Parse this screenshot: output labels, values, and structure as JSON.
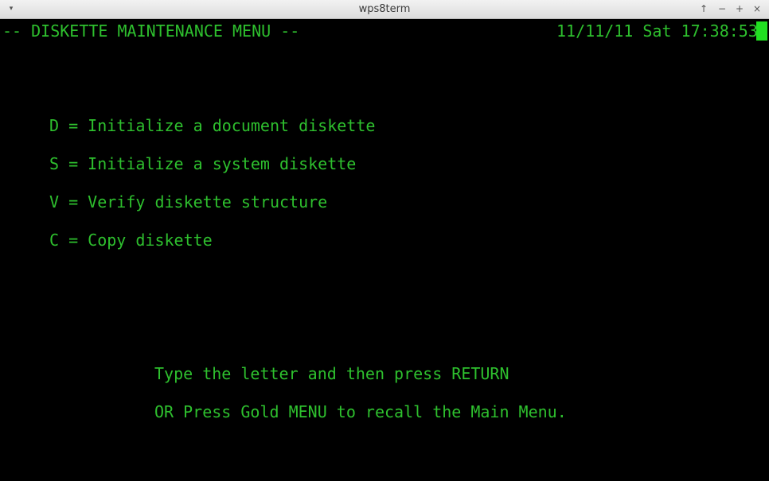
{
  "window": {
    "title": "wps8term",
    "controls": {
      "menu": "▾",
      "up": "↑",
      "minimize": "−",
      "maximize": "+",
      "close": "×"
    }
  },
  "terminal": {
    "colors": {
      "background": "#000000",
      "foreground": "#2ec02e",
      "cursor": "#21e021"
    },
    "header": {
      "title": "-- DISKETTE MAINTENANCE MENU --",
      "datetime": "11/11/11 Sat 17:38:53"
    },
    "options": [
      "D = Initialize a document diskette",
      "S = Initialize a system diskette",
      "V = Verify diskette structure",
      "C = Copy diskette"
    ],
    "prompt": {
      "line1": "Type the letter and then press RETURN",
      "line2": "OR Press Gold MENU to recall the Main Menu."
    }
  }
}
